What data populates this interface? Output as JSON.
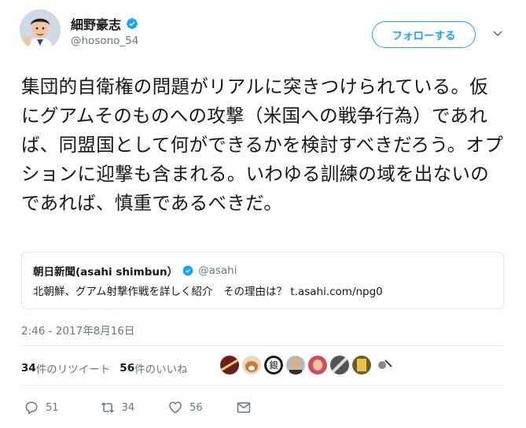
{
  "author": {
    "name": "細野豪志",
    "handle": "@hosono_54"
  },
  "follow_label": "フォローする",
  "tweet_text": "集団的自衛権の問題がリアルに突きつけられている。仮にグアムそのものへの攻撃（米国への戦争行為）であれば、同盟国として何ができるかを検討すべきだろう。オプションに迎撃も含まれる。いわゆる訓練の域を出ないのであれば、慎重であるべきだ。",
  "quote": {
    "name": "朝日新聞(asahi shimbun）",
    "handle": "@asahi",
    "text": "北朝鮮、グアム射撃作戦を詳しく紹介　その理由は？ t.asahi.com/npg0"
  },
  "timestamp": "2:46 - 2017年8月16日",
  "stats": {
    "retweets_count": "34",
    "retweets_label": "件のリツイート",
    "likes_count": "56",
    "likes_label": "件のいいね"
  },
  "actions": {
    "replies": "51",
    "retweets": "34",
    "likes": "56"
  },
  "colors": {
    "accent": "#1da1f2",
    "secondary_text": "#657786",
    "divider": "#e6ecf0"
  },
  "icons": [
    "verified-badge-icon",
    "chevron-down-icon",
    "reply-icon",
    "retweet-icon",
    "like-icon",
    "message-icon"
  ]
}
